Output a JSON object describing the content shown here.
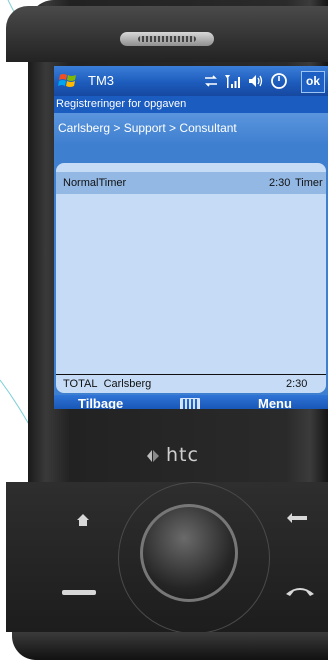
{
  "status_bar": {
    "app_name": "TM3",
    "ok_label": "ok",
    "icons": [
      "windows-flag-icon",
      "data-connection-icon",
      "signal-strength-icon",
      "speaker-icon",
      "clock-icon"
    ]
  },
  "window": {
    "title": "Registreringer for opgaven"
  },
  "breadcrumb": {
    "text": "Carlsberg > Support > Consultant"
  },
  "entries": [
    {
      "name": "NormalTimer",
      "hours": "2:30",
      "unit": "Timer"
    }
  ],
  "total": {
    "label": "TOTAL",
    "customer": "Carlsberg",
    "hours": "2:30"
  },
  "softkeys": {
    "left": "Tilbage",
    "right": "Menu",
    "center_icon": "keyboard-icon"
  },
  "device": {
    "brand": "htc"
  },
  "colors": {
    "header_blue": "#1a5cbf",
    "panel_light": "#c6dcf6",
    "selected_row": "#93b8e4"
  }
}
